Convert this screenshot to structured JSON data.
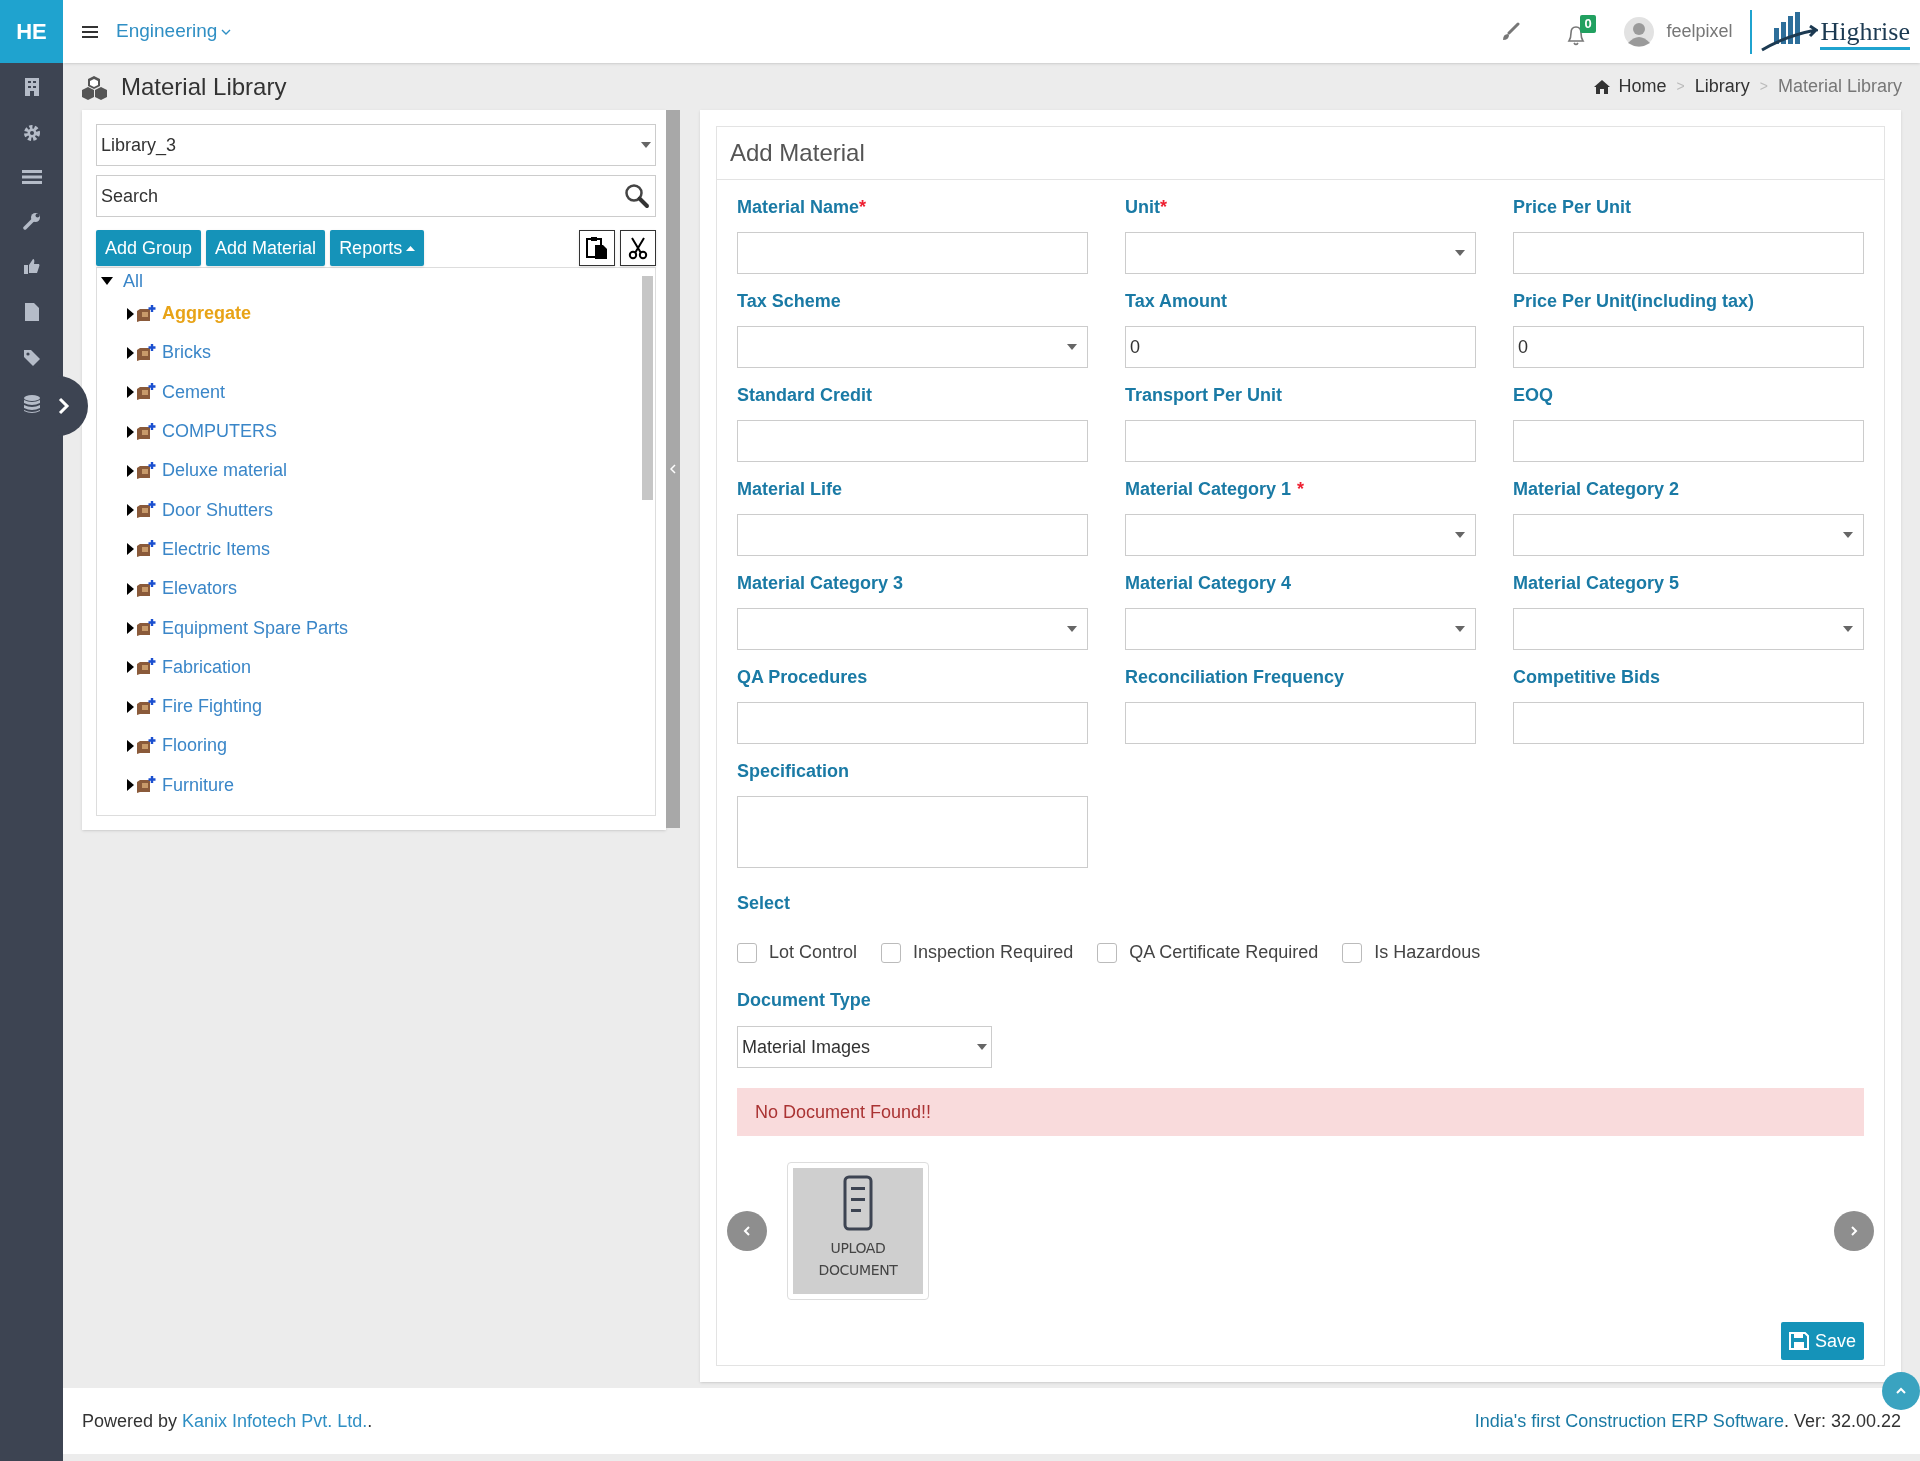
{
  "topbar": {
    "logo": "HE",
    "module": "Engineering",
    "notification_count": "0",
    "user": "feelpixel",
    "brand": "Highrise"
  },
  "page_title": "Material Library",
  "breadcrumb": [
    "Home",
    "Library",
    "Material Library"
  ],
  "breadcrumb_separator": ">",
  "library_select": {
    "value": "Library_3"
  },
  "search": {
    "placeholder": "Search"
  },
  "toolbar": [
    "Add Group",
    "Add Material",
    "Reports"
  ],
  "tree": {
    "label": "All",
    "expanded": true,
    "children": [
      {
        "label": "Aggregate",
        "selected": true,
        "expanded": false
      },
      {
        "label": "Bricks",
        "selected": false,
        "expanded": false
      },
      {
        "label": "Cement",
        "selected": false,
        "expanded": false
      },
      {
        "label": "COMPUTERS",
        "selected": false,
        "expanded": false
      },
      {
        "label": "Deluxe material",
        "selected": false,
        "expanded": false
      },
      {
        "label": "Door Shutters",
        "selected": false,
        "expanded": false
      },
      {
        "label": "Electric Items",
        "selected": false,
        "expanded": false
      },
      {
        "label": "Elevators",
        "selected": false,
        "expanded": false
      },
      {
        "label": "Equipment Spare Parts",
        "selected": false,
        "expanded": false
      },
      {
        "label": "Fabrication",
        "selected": false,
        "expanded": false
      },
      {
        "label": "Fire Fighting",
        "selected": false,
        "expanded": false
      },
      {
        "label": "Flooring",
        "selected": false,
        "expanded": false
      },
      {
        "label": "Furniture",
        "selected": false,
        "expanded": false
      }
    ]
  },
  "form": {
    "title": "Add Material",
    "fields": [
      {
        "label": "Material Name",
        "required": "*",
        "kind": "input"
      },
      {
        "label": "Unit",
        "required": "*",
        "kind": "select"
      },
      {
        "label": "Price Per Unit",
        "kind": "input"
      },
      {
        "label": "Tax Scheme",
        "kind": "select"
      },
      {
        "label": "Tax Amount",
        "kind": "input",
        "value": "0"
      },
      {
        "label": "Price Per Unit(including tax)",
        "kind": "input",
        "value": "0"
      },
      {
        "label": "Standard Credit",
        "kind": "input"
      },
      {
        "label": "Transport Per Unit",
        "kind": "input"
      },
      {
        "label": "EOQ",
        "kind": "input"
      },
      {
        "label": "Material Life",
        "kind": "input"
      },
      {
        "label": "Material Category 1",
        "required": "*",
        "kind": "select"
      },
      {
        "label": "Material Category 2",
        "kind": "select"
      },
      {
        "label": "Material Category 3",
        "kind": "select"
      },
      {
        "label": "Material Category 4",
        "kind": "select"
      },
      {
        "label": "Material Category 5",
        "kind": "select"
      },
      {
        "label": "QA Procedures",
        "kind": "input"
      },
      {
        "label": "Reconciliation Frequency",
        "kind": "input"
      },
      {
        "label": "Competitive Bids",
        "kind": "input"
      },
      {
        "label": "Specification",
        "kind": "textarea"
      }
    ],
    "select_label": "Select",
    "checkboxes": [
      {
        "label": "Lot Control",
        "checked": false
      },
      {
        "label": "Inspection Required",
        "checked": false
      },
      {
        "label": "QA Certificate Required",
        "checked": false
      },
      {
        "label": "Is Hazardous",
        "checked": false
      }
    ],
    "document_type": {
      "label": "Document Type",
      "value": "Material Images"
    },
    "alert": "No Document Found!!",
    "upload": "UPLOAD DOCUMENT",
    "save": "Save"
  },
  "footer": {
    "prefix": "Powered by ",
    "company": "Kanix Infotech Pvt. Ltd.",
    "suffix": ".",
    "tagline": "India's first Construction ERP Software",
    "version": ". Ver: 32.00.22"
  }
}
